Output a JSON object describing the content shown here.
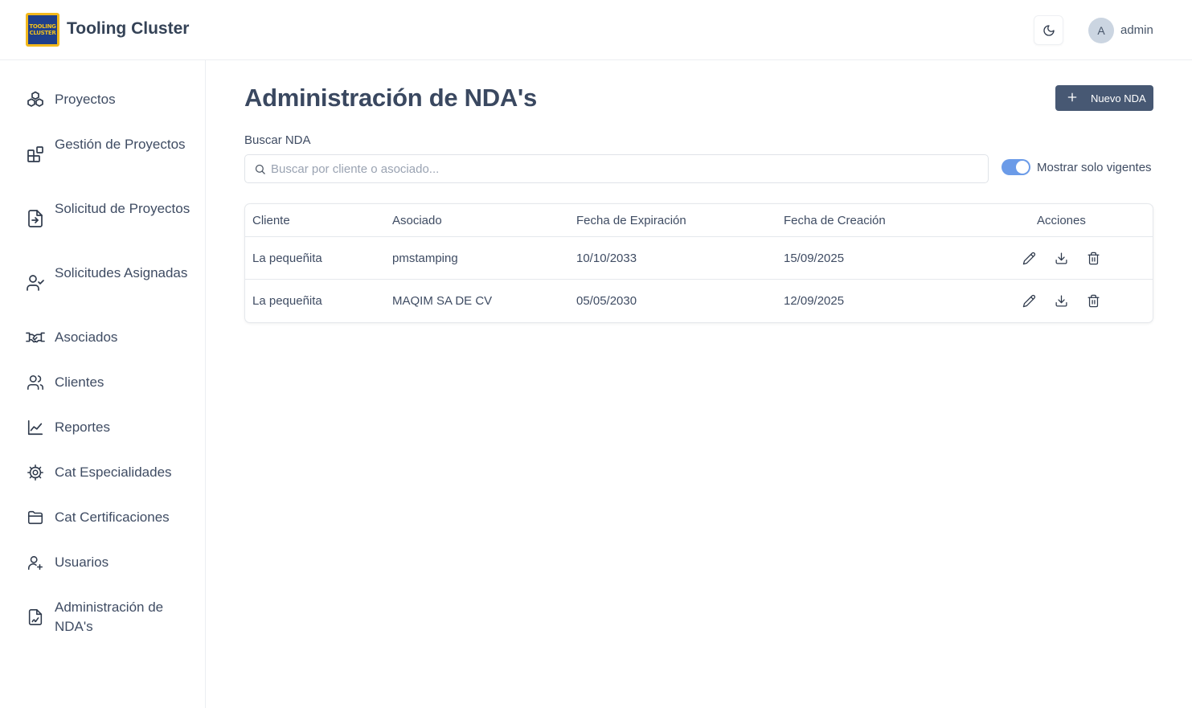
{
  "header": {
    "logo_text_line1": "TOOLING",
    "logo_text_line2": "CLUSTER",
    "app_title": "Tooling Cluster",
    "theme_icon": "moon-icon",
    "user": {
      "avatar_initial": "A",
      "name": "admin"
    }
  },
  "sidebar": {
    "items": [
      {
        "label": "Proyectos",
        "icon": "boxes-icon"
      },
      {
        "label": "Gestión de Proyectos",
        "icon": "blocks-icon"
      },
      {
        "label": "Solicitud de Proyectos",
        "icon": "file-input-icon"
      },
      {
        "label": "Solicitudes Asignadas",
        "icon": "user-check-icon"
      },
      {
        "label": "Asociados",
        "icon": "handshake-icon"
      },
      {
        "label": "Clientes",
        "icon": "users-icon"
      },
      {
        "label": "Reportes",
        "icon": "line-chart-icon"
      },
      {
        "label": "Cat Especialidades",
        "icon": "gear-icon"
      },
      {
        "label": "Cat Certificaciones",
        "icon": "folder-icon"
      },
      {
        "label": "Usuarios",
        "icon": "user-plus-icon"
      },
      {
        "label": "Administración de NDA's",
        "icon": "file-signature-icon"
      }
    ]
  },
  "main": {
    "title": "Administración de NDA's",
    "new_button_label": "Nuevo NDA",
    "search": {
      "label": "Buscar NDA",
      "placeholder": "Buscar por cliente o asociado...",
      "value": ""
    },
    "toggle": {
      "label": "Mostrar solo vigentes",
      "on": true
    },
    "table": {
      "columns": [
        "Cliente",
        "Asociado",
        "Fecha de Expiración",
        "Fecha de Creación",
        "Acciones"
      ],
      "rows": [
        {
          "cliente": "La pequeñita",
          "asociado": "pmstamping",
          "expiracion": "10/10/2033",
          "creacion": "15/09/2025"
        },
        {
          "cliente": "La pequeñita",
          "asociado": "MAQIM SA DE CV",
          "expiracion": "05/05/2030",
          "creacion": "12/09/2025"
        }
      ],
      "actions": [
        "edit-icon",
        "download-icon",
        "trash-icon"
      ]
    }
  },
  "colors": {
    "primary_button": "#475873",
    "toggle_on": "#6b9be8",
    "text": "#3f4c63"
  }
}
